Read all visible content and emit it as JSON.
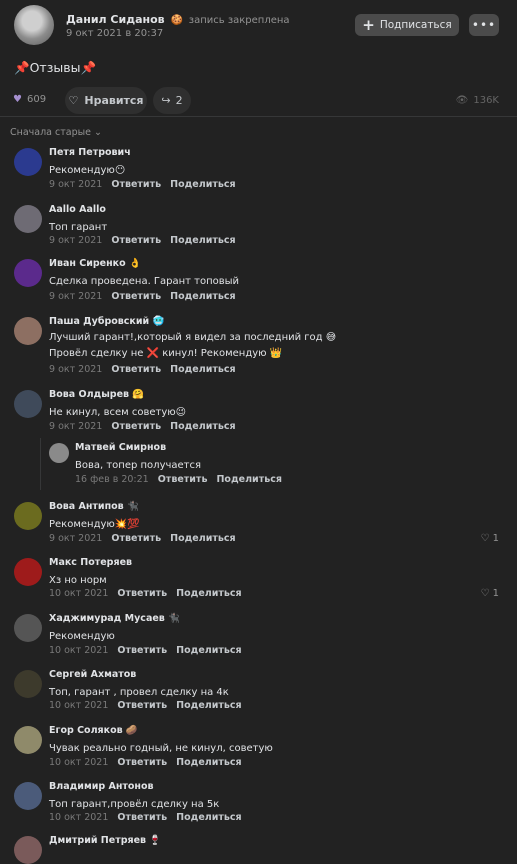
{
  "post": {
    "author": "Данил Сиданов",
    "author_emoji": "🍪",
    "pinned_note": "запись закреплена",
    "date": "9 окт 2021 в 20:37",
    "subscribe_label": "Подписаться",
    "more_label": "•••",
    "pin_left": "📌",
    "title": "Отзывы",
    "pin_right": "📌",
    "likes_count": "609",
    "like_label": "Нравится",
    "shares_count": "2",
    "views_count": "136K"
  },
  "sort_label": "Сначала старые",
  "actions": {
    "reply": "Ответить",
    "share": "Поделиться"
  },
  "comments": [
    {
      "name": "Петя Петрович",
      "lines": [
        "Рекомендую😶"
      ],
      "date": "9 окт 2021",
      "avatar_color": "#2b3a8f"
    },
    {
      "name": "Aallo Aallo",
      "lines": [
        "Топ гарант"
      ],
      "date": "9 окт 2021",
      "avatar_color": "#6e6b74"
    },
    {
      "name": "Иван Сиренко 👌",
      "lines": [
        "Сделка проведена. Гарант топовый"
      ],
      "date": "9 окт 2021",
      "avatar_color": "#5b2a8c"
    },
    {
      "name": "Паша Дубровский 🥶",
      "lines": [
        "Лучший гарант!,который я видел за последний год 😅",
        "Провёл сделку не ❌ кинул! Рекомендую 👑"
      ],
      "date": "9 окт 2021",
      "avatar_color": "#8d6f62"
    },
    {
      "name": "Вова Олдырев 🤗",
      "lines": [
        "Не кинул, всем советую😉"
      ],
      "date": "9 окт 2021",
      "avatar_color": "#3f4a5a"
    },
    {
      "name": "Матвей Смирнов",
      "lines": [
        "Вова, топер получается"
      ],
      "date": "16 фев в 20:21",
      "avatar_color": "#8a8a8a"
    },
    {
      "name": "Вова Антипов 🐈‍⬛",
      "lines": [
        "Рекомендую💥💯"
      ],
      "date": "9 окт 2021",
      "likes": "1",
      "avatar_color": "#6b6b1f"
    },
    {
      "name": "Макс Потеряев",
      "lines": [
        "Хз но норм"
      ],
      "date": "10 окт 2021",
      "likes": "1",
      "avatar_color": "#9e1b1b"
    },
    {
      "name": "Хаджимурад Мусаев 🐈‍⬛",
      "lines": [
        "Рекомендую"
      ],
      "date": "10 окт 2021",
      "avatar_color": "#555555"
    },
    {
      "name": "Сергей Ахматов",
      "lines": [
        "Топ, гарант , провел сделку на 4к"
      ],
      "date": "10 окт 2021",
      "avatar_color": "#3d3a2c"
    },
    {
      "name": "Егор Соляков 🥔",
      "lines": [
        "Чувак реально годный, не кинул, советую"
      ],
      "date": "10 окт 2021",
      "avatar_color": "#8f8a6a"
    },
    {
      "name": "Владимир Антонов",
      "lines": [
        "Топ гарант,провёл сделку на 5к"
      ],
      "date": "10 окт 2021",
      "avatar_color": "#4b5b7a"
    },
    {
      "name": "Дмитрий Петряев 🍷",
      "lines": [],
      "date": "",
      "avatar_color": "#7a5a5a"
    }
  ]
}
